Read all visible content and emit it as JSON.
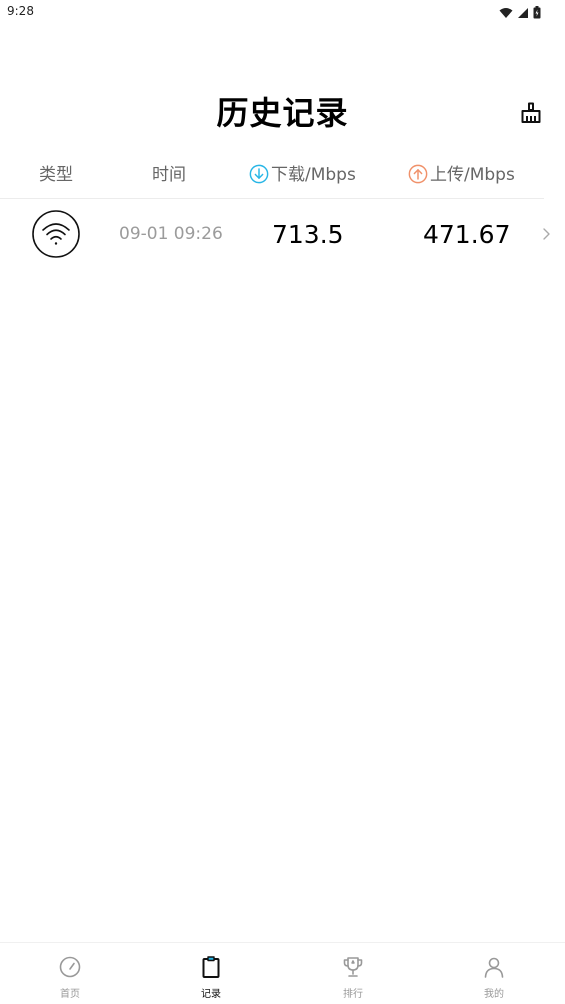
{
  "status_bar": {
    "time": "9:28"
  },
  "header": {
    "title": "历史记录"
  },
  "columns": {
    "type": "类型",
    "time": "时间",
    "download": "下载/Mbps",
    "upload": "上传/Mbps"
  },
  "records": [
    {
      "type_icon": "wifi-icon",
      "time": "09-01 09:26",
      "download": "713.5",
      "upload": "471.67"
    }
  ],
  "colors": {
    "download_accent": "#29b6e6",
    "upload_accent": "#f0916a",
    "active_nav": "#111111",
    "inactive_nav": "#999999"
  },
  "bottom_nav": {
    "items": [
      {
        "label": "首页",
        "icon": "speedometer-icon",
        "active": false
      },
      {
        "label": "记录",
        "icon": "clipboard-icon",
        "active": true
      },
      {
        "label": "排行",
        "icon": "trophy-icon",
        "active": false
      },
      {
        "label": "我的",
        "icon": "person-icon",
        "active": false
      }
    ]
  }
}
